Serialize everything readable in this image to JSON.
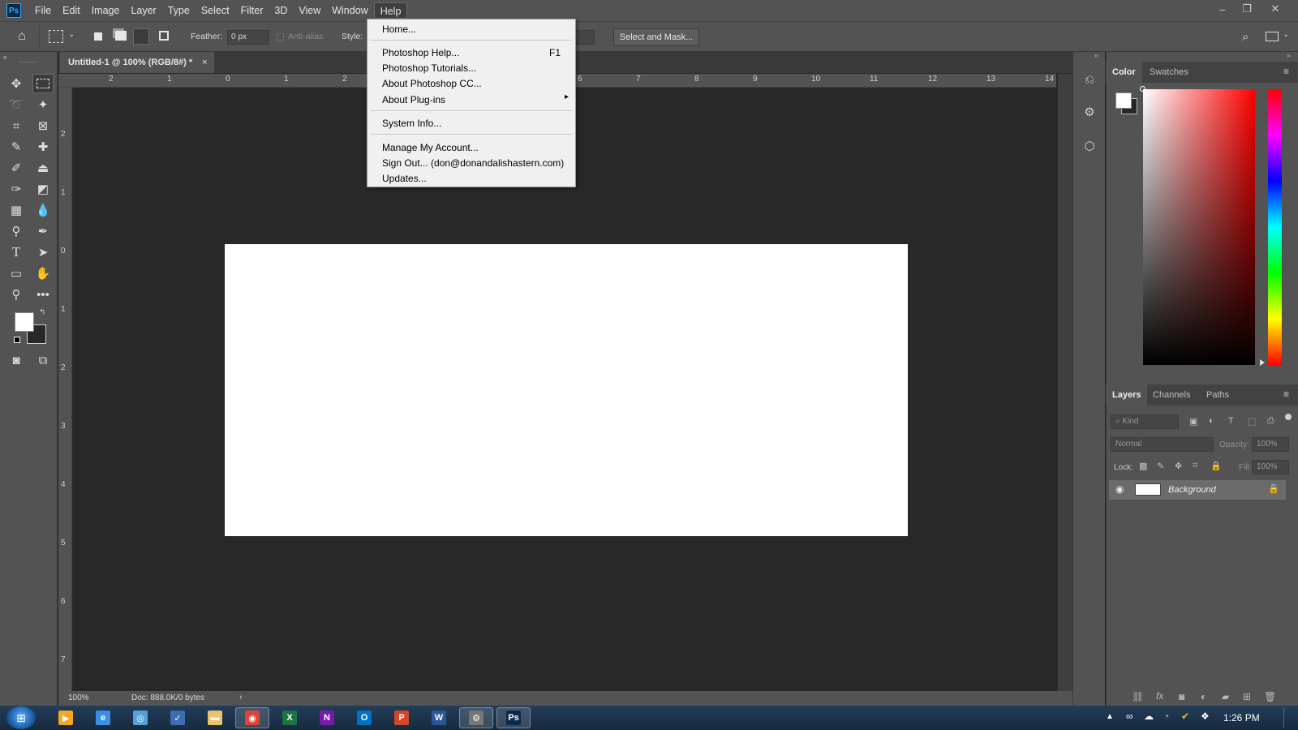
{
  "app": {
    "logo": "Ps",
    "menus": [
      "File",
      "Edit",
      "Image",
      "Layer",
      "Type",
      "Select",
      "Filter",
      "3D",
      "View",
      "Window",
      "Help"
    ],
    "window_controls": [
      "–",
      "❐",
      "✕"
    ]
  },
  "options_bar": {
    "feather_label": "Feather:",
    "feather_value": "0 px",
    "antialias_label": "Anti-alias",
    "style_label": "Style:",
    "select_mask_label": "Select and Mask..."
  },
  "document": {
    "tab_title": "Untitled-1 @ 100% (RGB/8#) *",
    "tab_close": "×",
    "zoom": "100%",
    "doc_info": "Doc: 888.0K/0 bytes",
    "ruler_top": [
      "2",
      "1",
      "0",
      "1",
      "2",
      "6",
      "7",
      "8",
      "9",
      "10",
      "11",
      "12",
      "13",
      "14"
    ],
    "ruler_left": [
      "2",
      "1",
      "0",
      "1",
      "2",
      "3",
      "4",
      "5",
      "6",
      "7"
    ]
  },
  "help_menu": {
    "items": [
      {
        "label": "Home..."
      },
      {
        "label": "Photoshop Help...",
        "shortcut": "F1"
      },
      {
        "label": "Photoshop Tutorials..."
      },
      {
        "label": "About Photoshop CC..."
      },
      {
        "label": "About Plug-ins",
        "submenu": "▸"
      },
      {
        "label": "System Info..."
      },
      {
        "label": "Manage My Account..."
      },
      {
        "label": "Sign Out... (don@donandalishastern.com)"
      },
      {
        "label": "Updates..."
      }
    ]
  },
  "color_panel": {
    "tabs": [
      "Color",
      "Swatches"
    ]
  },
  "layers_panel": {
    "tabs": [
      "Layers",
      "Channels",
      "Paths"
    ],
    "kind_placeholder": "Kind",
    "blend_mode": "Normal",
    "opacity_label": "Opacity:",
    "opacity_value": "100%",
    "lock_label": "Lock:",
    "fill_label": "Fill:",
    "fill_value": "100%",
    "layers": [
      {
        "name": "Background"
      }
    ]
  },
  "taskbar": {
    "apps": [
      {
        "name": "windows-media-icon",
        "label": "▶",
        "color": "#f5a623"
      },
      {
        "name": "ie-icon",
        "label": "e",
        "color": "#3a8ee6"
      },
      {
        "name": "globe-icon",
        "label": "◎",
        "color": "#5aa0d8"
      },
      {
        "name": "mail-check-icon",
        "label": "✓",
        "color": "#3b6fb0"
      },
      {
        "name": "folder-icon",
        "label": "▬",
        "color": "#e9c46a"
      },
      {
        "name": "chrome-icon",
        "label": "◉",
        "color": "#db4437"
      },
      {
        "name": "excel-icon",
        "label": "X",
        "color": "#1e7145"
      },
      {
        "name": "onenote-icon",
        "label": "N",
        "color": "#7719aa"
      },
      {
        "name": "outlook-icon",
        "label": "O",
        "color": "#0072c6"
      },
      {
        "name": "powerpoint-icon",
        "label": "P",
        "color": "#d24726"
      },
      {
        "name": "word-icon",
        "label": "W",
        "color": "#2b579a"
      },
      {
        "name": "app-icon",
        "label": "⚙",
        "color": "#777777"
      },
      {
        "name": "photoshop-icon",
        "label": "Ps",
        "color": "#0b2a4a"
      }
    ],
    "clock": "1:26 PM"
  }
}
